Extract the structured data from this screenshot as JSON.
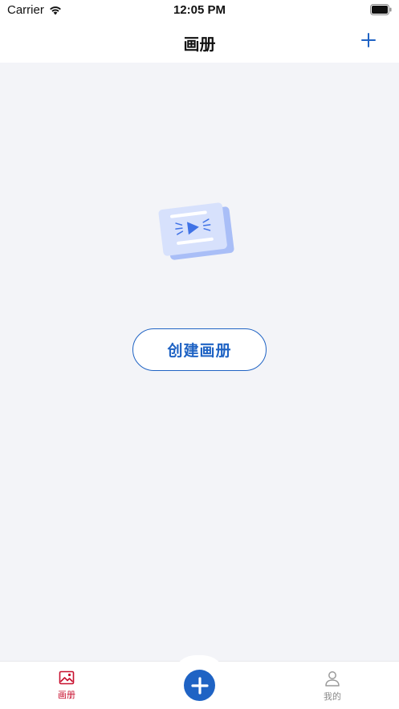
{
  "status_bar": {
    "carrier": "Carrier",
    "time": "12:05 PM"
  },
  "nav": {
    "title": "画册"
  },
  "empty_state": {
    "create_button_label": "创建画册"
  },
  "tab_bar": {
    "items": [
      {
        "label": "画册",
        "icon": "album-icon",
        "active": true
      },
      {
        "label": "我的",
        "icon": "user-icon",
        "active": false
      }
    ],
    "center_icon": "plus-icon"
  },
  "colors": {
    "accent": "#1f63c4",
    "active_tab": "#c8102e",
    "inactive_tab": "#8a8a8a",
    "background": "#f3f4f8"
  }
}
